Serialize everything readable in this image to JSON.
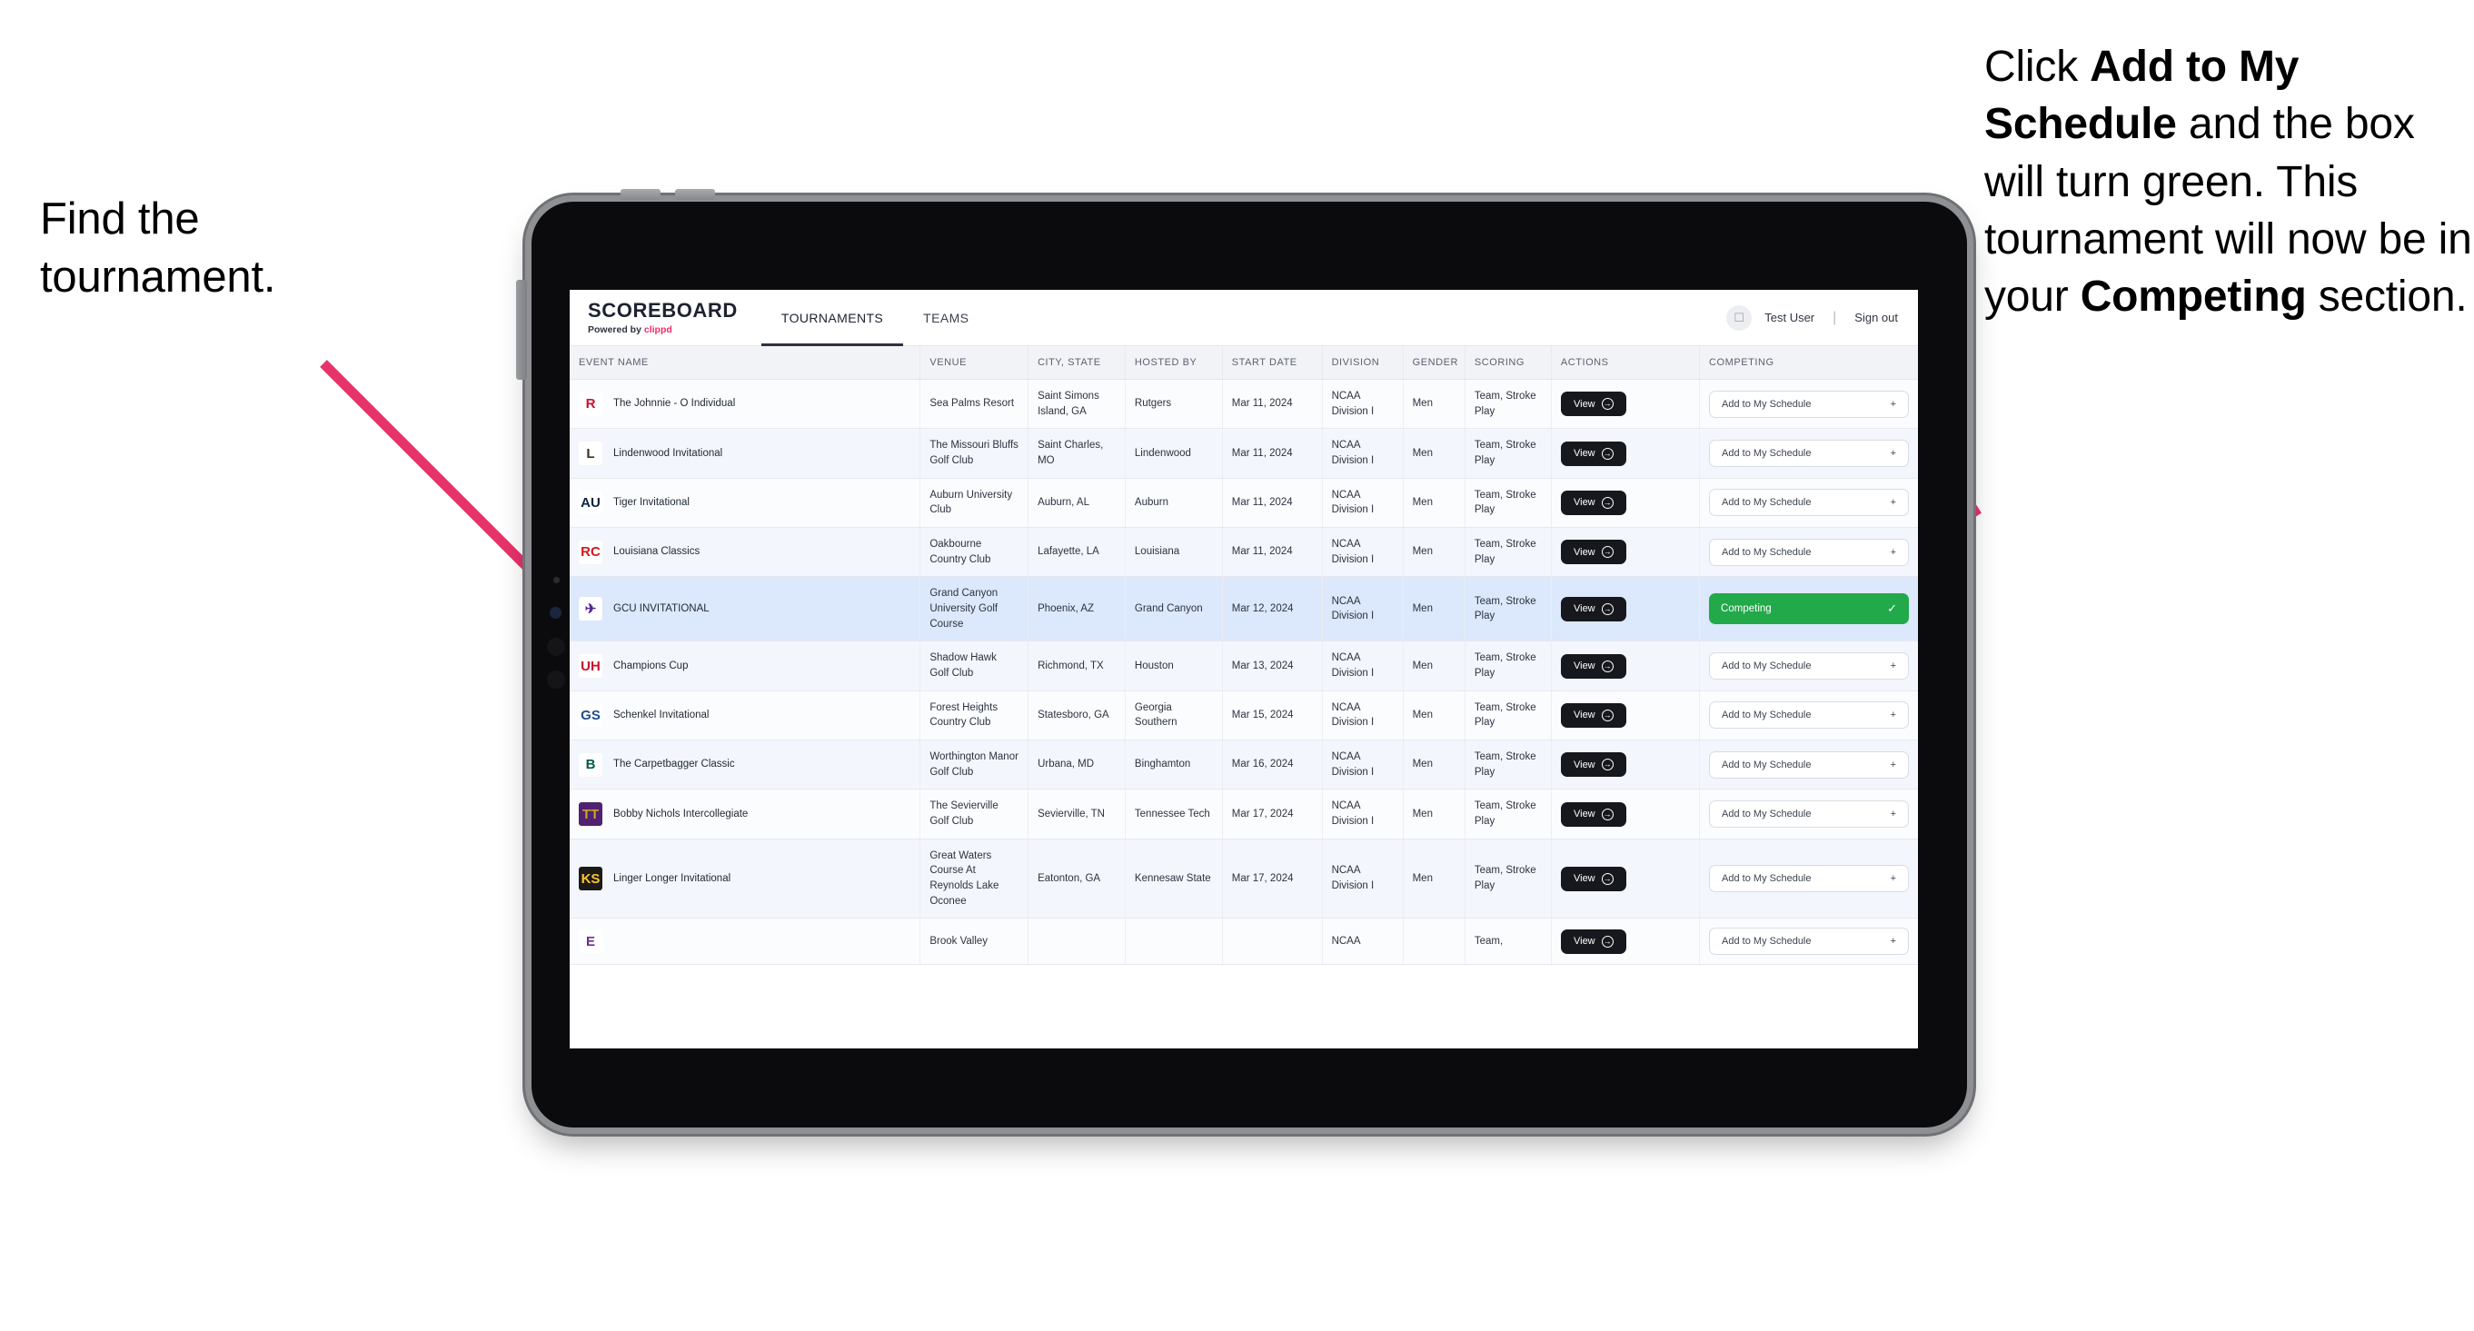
{
  "annotations": {
    "left": "Find the tournament.",
    "right_parts": [
      {
        "text": "Click ",
        "bold": false
      },
      {
        "text": "Add to My Schedule",
        "bold": true
      },
      {
        "text": " and the box will turn green. This tournament will now be in your ",
        "bold": false
      },
      {
        "text": "Competing",
        "bold": true
      },
      {
        "text": " section.",
        "bold": false
      }
    ],
    "arrow_color": "#e6336b"
  },
  "app": {
    "brand": {
      "title": "SCOREBOARD",
      "powered_prefix": "Powered by ",
      "powered_brand": "clippd",
      "brand_color": "#ef2b63"
    },
    "tabs": [
      {
        "label": "TOURNAMENTS",
        "active": true
      },
      {
        "label": "TEAMS",
        "active": false
      }
    ],
    "user": {
      "avatar_icon": "user-avatar-icon",
      "name": "Test User",
      "separator": "|",
      "sign_out": "Sign out"
    }
  },
  "table": {
    "columns": [
      "EVENT NAME",
      "VENUE",
      "CITY, STATE",
      "HOSTED BY",
      "START DATE",
      "DIVISION",
      "GENDER",
      "SCORING",
      "ACTIONS",
      "COMPETING"
    ],
    "view_label": "View",
    "add_label": "Add to My Schedule",
    "add_plus": "+",
    "competing_label": "Competing",
    "competing_check": "✓",
    "competing_color": "#22a94a",
    "rows": [
      {
        "logo": {
          "text": "R",
          "color": "#c8102e",
          "bg": "#ffffff"
        },
        "event": "The Johnnie - O Individual",
        "venue": "Sea Palms Resort",
        "city": "Saint Simons Island, GA",
        "host": "Rutgers",
        "date": "Mar 11, 2024",
        "division": "NCAA Division I",
        "gender": "Men",
        "scoring": "Team, Stroke Play",
        "competing": false,
        "selected": false
      },
      {
        "logo": {
          "text": "L",
          "color": "#3b2f1e",
          "bg": "#ffffff"
        },
        "event": "Lindenwood Invitational",
        "venue": "The Missouri Bluffs Golf Club",
        "city": "Saint Charles, MO",
        "host": "Lindenwood",
        "date": "Mar 11, 2024",
        "division": "NCAA Division I",
        "gender": "Men",
        "scoring": "Team, Stroke Play",
        "competing": false,
        "selected": false
      },
      {
        "logo": {
          "text": "AU",
          "color": "#0c2340",
          "bg": "#ffffff"
        },
        "event": "Tiger Invitational",
        "venue": "Auburn University Club",
        "city": "Auburn, AL",
        "host": "Auburn",
        "date": "Mar 11, 2024",
        "division": "NCAA Division I",
        "gender": "Men",
        "scoring": "Team, Stroke Play",
        "competing": false,
        "selected": false
      },
      {
        "logo": {
          "text": "RC",
          "color": "#ce181e",
          "bg": "#ffffff"
        },
        "event": "Louisiana Classics",
        "venue": "Oakbourne Country Club",
        "city": "Lafayette, LA",
        "host": "Louisiana",
        "date": "Mar 11, 2024",
        "division": "NCAA Division I",
        "gender": "Men",
        "scoring": "Team, Stroke Play",
        "competing": false,
        "selected": false
      },
      {
        "logo": {
          "text": "✈",
          "color": "#522398",
          "bg": "#ffffff"
        },
        "event": "GCU INVITATIONAL",
        "venue": "Grand Canyon University Golf Course",
        "city": "Phoenix, AZ",
        "host": "Grand Canyon",
        "date": "Mar 12, 2024",
        "division": "NCAA Division I",
        "gender": "Men",
        "scoring": "Team, Stroke Play",
        "competing": true,
        "selected": true
      },
      {
        "logo": {
          "text": "UH",
          "color": "#c8102e",
          "bg": "#ffffff"
        },
        "event": "Champions Cup",
        "venue": "Shadow Hawk Golf Club",
        "city": "Richmond, TX",
        "host": "Houston",
        "date": "Mar 13, 2024",
        "division": "NCAA Division I",
        "gender": "Men",
        "scoring": "Team, Stroke Play",
        "competing": false,
        "selected": false
      },
      {
        "logo": {
          "text": "GS",
          "color": "#1e4d8c",
          "bg": "#ffffff"
        },
        "event": "Schenkel Invitational",
        "venue": "Forest Heights Country Club",
        "city": "Statesboro, GA",
        "host": "Georgia Southern",
        "date": "Mar 15, 2024",
        "division": "NCAA Division I",
        "gender": "Men",
        "scoring": "Team, Stroke Play",
        "competing": false,
        "selected": false
      },
      {
        "logo": {
          "text": "B",
          "color": "#005a43",
          "bg": "#ffffff"
        },
        "event": "The Carpetbagger Classic",
        "venue": "Worthington Manor Golf Club",
        "city": "Urbana, MD",
        "host": "Binghamton",
        "date": "Mar 16, 2024",
        "division": "NCAA Division I",
        "gender": "Men",
        "scoring": "Team, Stroke Play",
        "competing": false,
        "selected": false
      },
      {
        "logo": {
          "text": "TT",
          "color": "#c8a426",
          "bg": "#4f2170"
        },
        "event": "Bobby Nichols Intercollegiate",
        "venue": "The Sevierville Golf Club",
        "city": "Sevierville, TN",
        "host": "Tennessee Tech",
        "date": "Mar 17, 2024",
        "division": "NCAA Division I",
        "gender": "Men",
        "scoring": "Team, Stroke Play",
        "competing": false,
        "selected": false
      },
      {
        "logo": {
          "text": "KS",
          "color": "#ffc629",
          "bg": "#1a1a1a"
        },
        "event": "Linger Longer Invitational",
        "venue": "Great Waters Course At Reynolds Lake Oconee",
        "city": "Eatonton, GA",
        "host": "Kennesaw State",
        "date": "Mar 17, 2024",
        "division": "NCAA Division I",
        "gender": "Men",
        "scoring": "Team, Stroke Play",
        "competing": false,
        "selected": false
      },
      {
        "logo": {
          "text": "E",
          "color": "#6b2f8f",
          "bg": "#ffffff"
        },
        "event": "",
        "venue": "Brook Valley",
        "city": "",
        "host": "",
        "date": "",
        "division": "NCAA",
        "gender": "",
        "scoring": "Team,",
        "competing": false,
        "selected": false
      }
    ]
  }
}
